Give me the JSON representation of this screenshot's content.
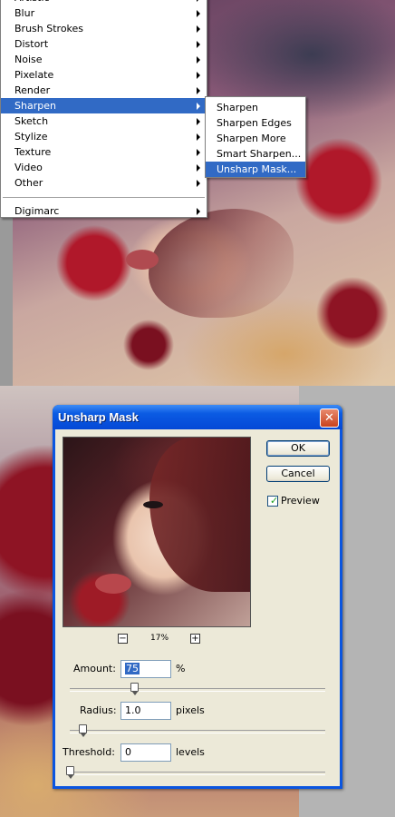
{
  "filter_menu": {
    "items": [
      {
        "label": "Artistic",
        "has_submenu": true
      },
      {
        "label": "Blur",
        "has_submenu": true
      },
      {
        "label": "Brush Strokes",
        "has_submenu": true
      },
      {
        "label": "Distort",
        "has_submenu": true
      },
      {
        "label": "Noise",
        "has_submenu": true
      },
      {
        "label": "Pixelate",
        "has_submenu": true
      },
      {
        "label": "Render",
        "has_submenu": true
      },
      {
        "label": "Sharpen",
        "has_submenu": true,
        "selected": true
      },
      {
        "label": "Sketch",
        "has_submenu": true
      },
      {
        "label": "Stylize",
        "has_submenu": true
      },
      {
        "label": "Texture",
        "has_submenu": true
      },
      {
        "label": "Video",
        "has_submenu": true
      },
      {
        "label": "Other",
        "has_submenu": true
      }
    ],
    "extra_items": [
      {
        "label": "Digimarc",
        "has_submenu": true
      }
    ]
  },
  "sharpen_submenu": {
    "items": [
      {
        "label": "Sharpen"
      },
      {
        "label": "Sharpen Edges"
      },
      {
        "label": "Sharpen More"
      },
      {
        "label": "Smart Sharpen..."
      },
      {
        "label": "Unsharp Mask...",
        "selected": true
      }
    ]
  },
  "dialog": {
    "title": "Unsharp Mask",
    "close_glyph": "✕",
    "ok_label": "OK",
    "cancel_label": "Cancel",
    "preview_label": "Preview",
    "preview_checked": true,
    "zoom_out_glyph": "−",
    "zoom_in_glyph": "+",
    "zoom_level": "17%",
    "amount": {
      "label": "Amount:",
      "value": "75",
      "unit": "%",
      "slider_fraction": 0.25
    },
    "radius": {
      "label": "Radius:",
      "value": "1.0",
      "unit": "pixels",
      "slider_fraction": 0.05
    },
    "threshold": {
      "label": "Threshold:",
      "value": "0",
      "unit": "levels",
      "slider_fraction": 0.0
    }
  },
  "colors": {
    "menu_highlight": "#316ac5",
    "titlebar": "#0b5be3",
    "dialog_face": "#ece9d8",
    "close_button": "#c9421e"
  },
  "icons": {
    "submenu_arrow": "triangle-right",
    "close": "close-icon",
    "checkbox": "check-icon"
  }
}
